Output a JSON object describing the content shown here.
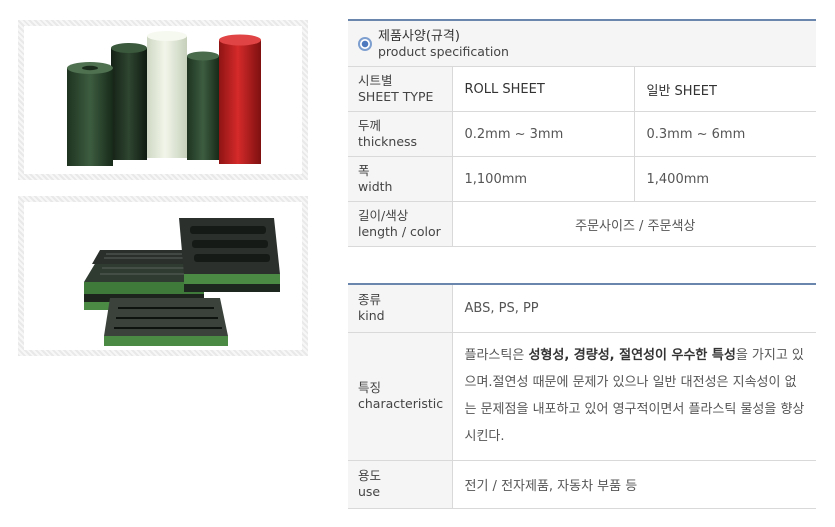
{
  "spec": {
    "header_ko": "제품사양(규격)",
    "header_en": "product specification",
    "rows": [
      {
        "label_ko": "시트별",
        "label_en": "SHEET TYPE",
        "roll": "ROLL SHEET",
        "general": "일반 SHEET"
      },
      {
        "label_ko": "두께",
        "label_en": "thickness",
        "roll": "0.2mm ~ 3mm",
        "general": "0.3mm ~ 6mm"
      },
      {
        "label_ko": "폭",
        "label_en": "width",
        "roll": "1,100mm",
        "general": "1,400mm"
      }
    ],
    "length_label_ko": "길이/색상",
    "length_label_en": "length / color",
    "length_value": "주문사이즈 / 주문색상"
  },
  "kind": {
    "label_ko": "종류",
    "label_en": "kind",
    "value": "ABS, PS, PP"
  },
  "characteristic": {
    "label_ko": "특징",
    "label_en": "characteristic",
    "text_1": "플라스틱은 ",
    "bold_1": "성형성, 경량성, 절연성이 우수한 특성",
    "text_2": "을 가지고 있으며.절연성 때문에 문제가 있으나 일반 대전성은 지속성이 없는 문제점을 내포하고 있어 영구적이면서 플라스틱 물성을 향상시킨다."
  },
  "use": {
    "label_ko": "용도",
    "label_en": "use",
    "value": "전기 / 전자제품, 자동차 부품 등"
  },
  "colors": {
    "header_accent": "#6b86ad",
    "label_bg": "#f5f5f5",
    "border": "#d9d9d9"
  }
}
